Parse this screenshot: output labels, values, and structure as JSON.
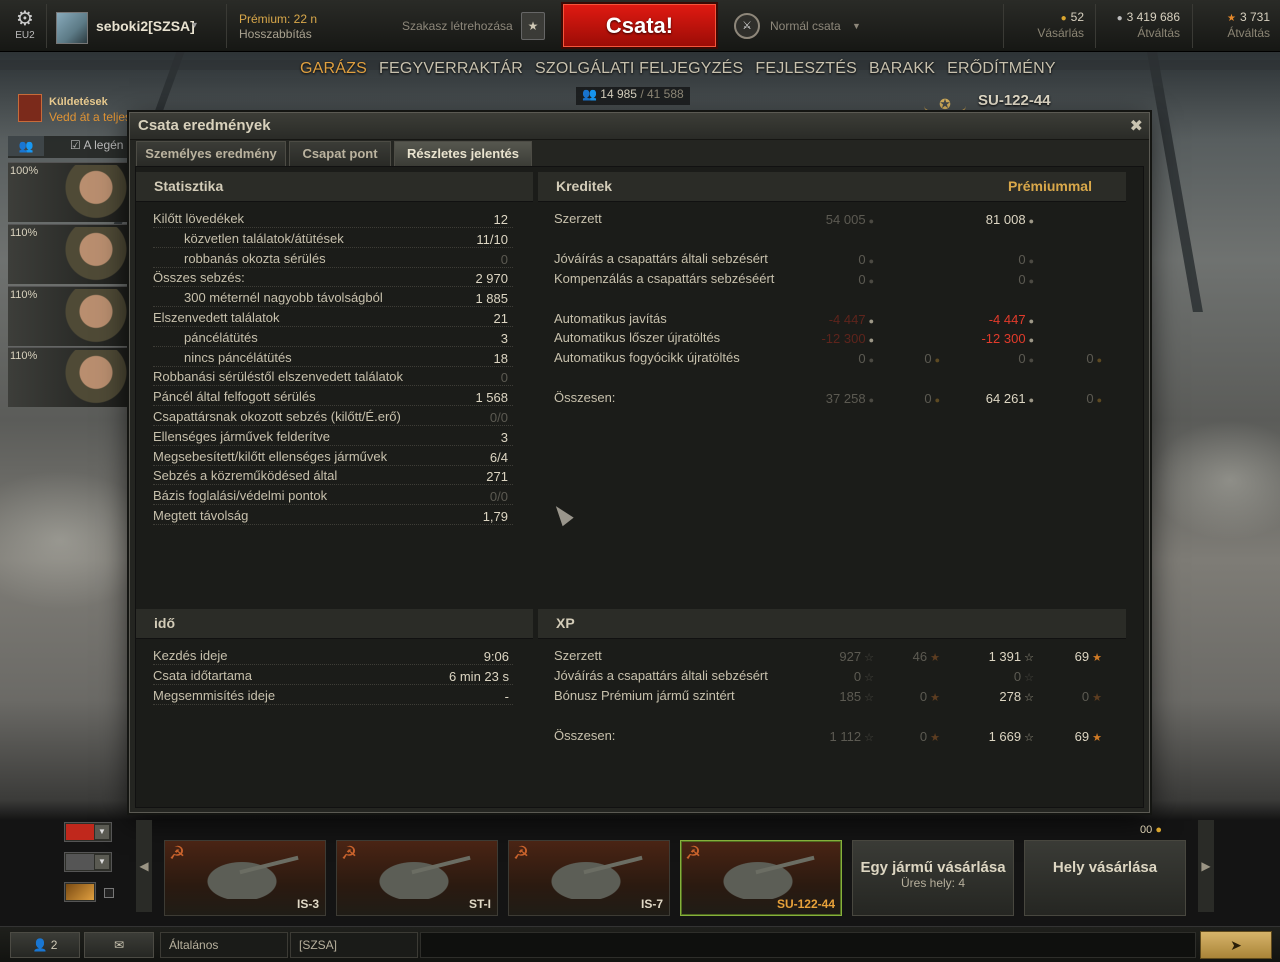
{
  "topbar": {
    "settings_icon": "gear-icon",
    "server": "EU2",
    "username": "seboki2[SZSA]",
    "premium": "Prémium: 22 n",
    "premium_extend": "Hosszabbítás",
    "platoon_create": "Szakasz létrehozása",
    "battle_button": "Csata!",
    "battle_mode": "Normál csata",
    "gold": {
      "value": "52",
      "label": "Vásárlás",
      "icon": "gold-coin-icon"
    },
    "credits": {
      "value": "3 419 686",
      "label": "Átváltás",
      "icon": "credits-icon"
    },
    "free_xp": {
      "value": "3 731",
      "label": "Átváltás",
      "icon": "star-icon"
    }
  },
  "nav": [
    "GARÁZS",
    "FEGYVERRAKTÁR",
    "SZOLGÁLATI FELJEGYZÉS",
    "FEJLESZTÉS",
    "BARAKK",
    "ERŐDÍTMÉNY"
  ],
  "nav_active": 0,
  "server_counter": {
    "value": "14 985",
    "total": "/ 41 588"
  },
  "tank_title": "SU-122-44",
  "missions": {
    "title": "Küldetések",
    "subtitle": "Vedd át a teljes"
  },
  "crew_filter": "A legén",
  "crew": [
    {
      "pct": "100%"
    },
    {
      "pct": "110%"
    },
    {
      "pct": "110%"
    },
    {
      "pct": "110%"
    }
  ],
  "dialog": {
    "title": "Csata eredmények",
    "tabs": [
      "Személyes eredmény",
      "Csapat pont",
      "Részletes jelentés"
    ],
    "active_tab": 2,
    "stats": {
      "header": "Statisztika",
      "rows": [
        {
          "label": "Kilőtt lövedékek",
          "value": "12",
          "indent": false,
          "dim": false
        },
        {
          "label": "közvetlen találatok/átütések",
          "value": "11/10",
          "indent": true,
          "dim": false
        },
        {
          "label": "robbanás okozta sérülés",
          "value": "0",
          "indent": true,
          "dim": true
        },
        {
          "label": "Összes sebzés:",
          "value": "2 970",
          "indent": false,
          "dim": false
        },
        {
          "label": "300 méternél nagyobb távolságból",
          "value": "1 885",
          "indent": true,
          "dim": false
        },
        {
          "label": "Elszenvedett találatok",
          "value": "21",
          "indent": false,
          "dim": false
        },
        {
          "label": "páncélátütés",
          "value": "3",
          "indent": true,
          "dim": false
        },
        {
          "label": "nincs páncélátütés",
          "value": "18",
          "indent": true,
          "dim": false
        },
        {
          "label": "Robbanási sérüléstől elszenvedett találatok",
          "value": "0",
          "indent": false,
          "dim": true
        },
        {
          "label": "Páncél által felfogott sérülés",
          "value": "1 568",
          "indent": false,
          "dim": false
        },
        {
          "label": "Csapattársnak okozott sebzés (kilőtt/É.erő)",
          "value": "0/0",
          "indent": false,
          "dim": true
        },
        {
          "label": "Ellenséges járművek felderítve",
          "value": "3",
          "indent": false,
          "dim": false
        },
        {
          "label": "Megsebesített/kilőtt ellenséges járművek",
          "value": "6/4",
          "indent": false,
          "dim": false
        },
        {
          "label": "Sebzés a közreműködésed által",
          "value": "271",
          "indent": false,
          "dim": false
        },
        {
          "label": "Bázis foglalási/védelmi pontok",
          "value": "0/0",
          "indent": false,
          "dim": true
        },
        {
          "label": "Megtett távolság",
          "value": "1,79",
          "indent": false,
          "dim": false
        }
      ]
    },
    "credits": {
      "header": "Kreditek",
      "premium_header": "Prémiummal",
      "rows": [
        {
          "label": "Szerzett",
          "base": "54 005",
          "base_gold": "",
          "prem": "81 008",
          "prem_gold": "",
          "base_style": "dim",
          "prem_style": "normal"
        },
        {
          "label": "",
          "base": "",
          "base_gold": "",
          "prem": "",
          "prem_gold": "",
          "base_style": "dim",
          "prem_style": "normal"
        },
        {
          "label": "Jóváírás a csapattárs általi sebzésért",
          "base": "0",
          "base_gold": "",
          "prem": "0",
          "prem_gold": "",
          "base_style": "dim",
          "prem_style": "dim"
        },
        {
          "label": "Kompenzálás a csapattárs sebzéséért",
          "base": "0",
          "base_gold": "",
          "prem": "0",
          "prem_gold": "",
          "base_style": "dim",
          "prem_style": "dim"
        },
        {
          "label": "",
          "base": "",
          "base_gold": "",
          "prem": "",
          "prem_gold": "",
          "base_style": "dim",
          "prem_style": "normal"
        },
        {
          "label": "Automatikus javítás",
          "base": "-4 447",
          "base_gold": "",
          "prem": "-4 447",
          "prem_gold": "",
          "base_style": "dimred",
          "prem_style": "red"
        },
        {
          "label": "Automatikus lőszer újratöltés",
          "base": "-12 300",
          "base_gold": "",
          "prem": "-12 300",
          "prem_gold": "",
          "base_style": "dimred",
          "prem_style": "red"
        },
        {
          "label": "Automatikus fogyócikk újratöltés",
          "base": "0",
          "base_gold": "0",
          "prem": "0",
          "prem_gold": "0",
          "base_style": "dim",
          "prem_style": "dim"
        },
        {
          "label": "",
          "base": "",
          "base_gold": "",
          "prem": "",
          "prem_gold": "",
          "base_style": "dim",
          "prem_style": "normal"
        },
        {
          "label": "Összesen:",
          "base": "37 258",
          "base_gold": "0",
          "prem": "64 261",
          "prem_gold": "0",
          "base_style": "dim",
          "prem_style": "normal"
        }
      ]
    },
    "time": {
      "header": "idő",
      "rows": [
        {
          "label": "Kezdés ideje",
          "value": "9:06"
        },
        {
          "label": "Csata időtartama",
          "value": "6 min 23 s"
        },
        {
          "label": "Megsemmisítés ideje",
          "value": "-"
        }
      ]
    },
    "xp": {
      "header": "XP",
      "rows": [
        {
          "label": "Szerzett",
          "base": "927",
          "base_free": "46",
          "prem": "1 391",
          "prem_free": "69",
          "prem_free_dim": false
        },
        {
          "label": "Jóváírás a csapattárs általi sebzésért",
          "base": "0",
          "base_free": "",
          "prem": "0",
          "prem_free": "",
          "prem_free_dim": true
        },
        {
          "label": "Bónusz Prémium jármű szintért",
          "base": "185",
          "base_free": "0",
          "prem": "278",
          "prem_free": "0",
          "prem_free_dim": true
        },
        {
          "label": "",
          "base": "",
          "base_free": "",
          "prem": "",
          "prem_free": "",
          "prem_free_dim": true
        },
        {
          "label": "Összesen:",
          "base": "1 112",
          "base_free": "0",
          "prem": "1 669",
          "prem_free": "69",
          "prem_free_dim": false
        }
      ]
    }
  },
  "carousel": {
    "tanks": [
      {
        "name": "IS-3",
        "selected": false
      },
      {
        "name": "ST-I",
        "selected": false
      },
      {
        "name": "IS-7",
        "selected": false
      },
      {
        "name": "SU-122-44",
        "selected": true
      }
    ],
    "buy_vehicle": "Egy jármű vásárlása",
    "free_slots": "Üres hely: 4",
    "buy_slot": "Hely vásárlása",
    "gold_hint": "00"
  },
  "bottombar": {
    "contacts_count": "2",
    "channel_general": "Általános",
    "channel_clan": "[SZSA]"
  },
  "colors": {
    "accent": "#e0a040",
    "battle_red": "#d0160e",
    "damage_red": "#e23b2b"
  }
}
